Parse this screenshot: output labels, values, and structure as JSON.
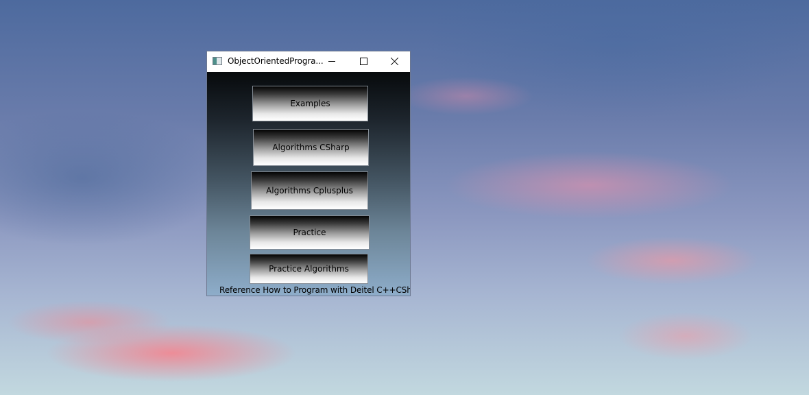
{
  "window": {
    "title": "ObjectOrientedProgra...",
    "app_icon": "window-app-icon",
    "controls": {
      "minimize_icon": "minimize-icon",
      "maximize_icon": "maximize-icon",
      "close_icon": "close-icon"
    }
  },
  "buttons": [
    {
      "label": "Examples"
    },
    {
      "label": "Algorithms CSharp"
    },
    {
      "label": "Algorithms Cplusplus"
    },
    {
      "label": "Practice"
    },
    {
      "label": "Practice Algorithms"
    }
  ],
  "reference": "Reference How to Program with Deitel C++CSharp",
  "colors": {
    "client_gradient_top": "#070a0c",
    "client_gradient_bottom": "#8eadca",
    "button_gradient_top": "#030303",
    "button_gradient_bottom": "#ffffff"
  }
}
